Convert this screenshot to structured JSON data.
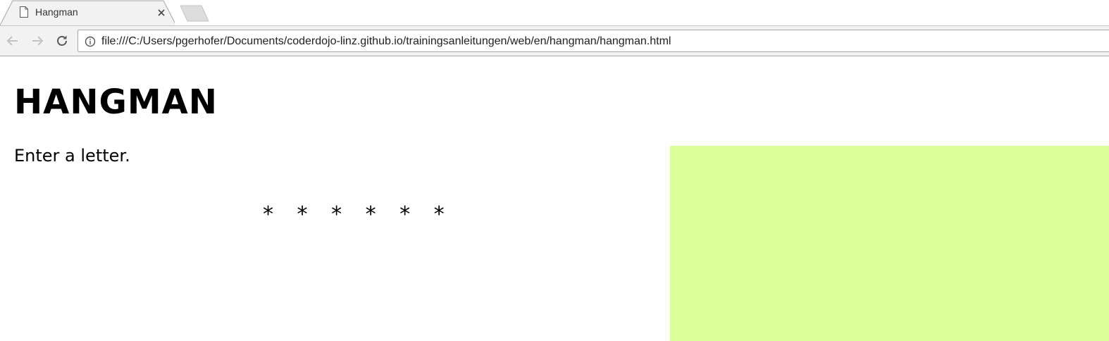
{
  "tab": {
    "title": "Hangman",
    "favicon": "page-icon",
    "close": "close-icon"
  },
  "toolbar": {
    "back_icon": "back-arrow-icon",
    "forward_icon": "forward-arrow-icon",
    "reload_icon": "reload-icon",
    "info_icon": "info-icon",
    "url": "file:///C:/Users/pgerhofer/Documents/coderdojo-linz.github.io/trainingsanleitungen/web/en/hangman/hangman.html"
  },
  "page": {
    "title": "HANGMAN",
    "prompt": "Enter a letter.",
    "masked_word": "* * * * * *",
    "drawing_background": "#dcff99"
  },
  "colors": {
    "tab_strip": "#ffffff",
    "toolbar": "#f2f2f2",
    "drawing_area": "#dcff99"
  }
}
